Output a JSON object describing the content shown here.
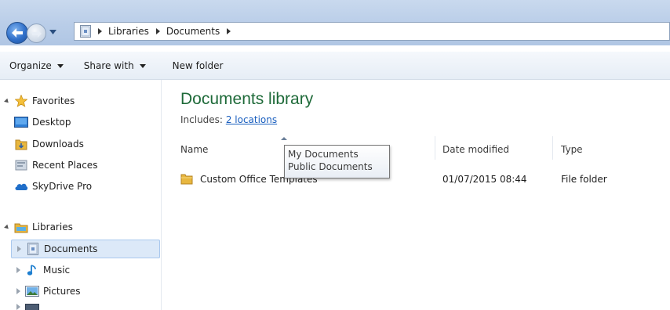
{
  "address_bar": {
    "breadcrumbs": [
      "Libraries",
      "Documents"
    ]
  },
  "toolbar": {
    "organize_label": "Organize",
    "share_label": "Share with",
    "new_folder_label": "New folder"
  },
  "nav": {
    "favorites": {
      "label": "Favorites",
      "items": [
        {
          "label": "Desktop",
          "icon": "desktop-icon"
        },
        {
          "label": "Downloads",
          "icon": "downloads-icon"
        },
        {
          "label": "Recent Places",
          "icon": "recent-places-icon"
        },
        {
          "label": "SkyDrive Pro",
          "icon": "skydrive-icon"
        }
      ]
    },
    "libraries": {
      "label": "Libraries",
      "items": [
        {
          "label": "Documents",
          "icon": "documents-icon",
          "selected": true
        },
        {
          "label": "Music",
          "icon": "music-icon"
        },
        {
          "label": "Pictures",
          "icon": "pictures-icon"
        }
      ]
    }
  },
  "library": {
    "title": "Documents library",
    "includes_label": "Includes:",
    "locations_link": "2 locations"
  },
  "columns": {
    "name": "Name",
    "date_modified": "Date modified",
    "type": "Type"
  },
  "files": [
    {
      "name": "Custom Office Templates",
      "date_modified": "01/07/2015 08:44",
      "type": "File folder"
    }
  ],
  "tooltip": {
    "lines": [
      "My Documents",
      "Public Documents"
    ]
  },
  "colors": {
    "library_title": "#1e6a39",
    "link": "#1a5fbf",
    "selection": "#dce9f8"
  }
}
